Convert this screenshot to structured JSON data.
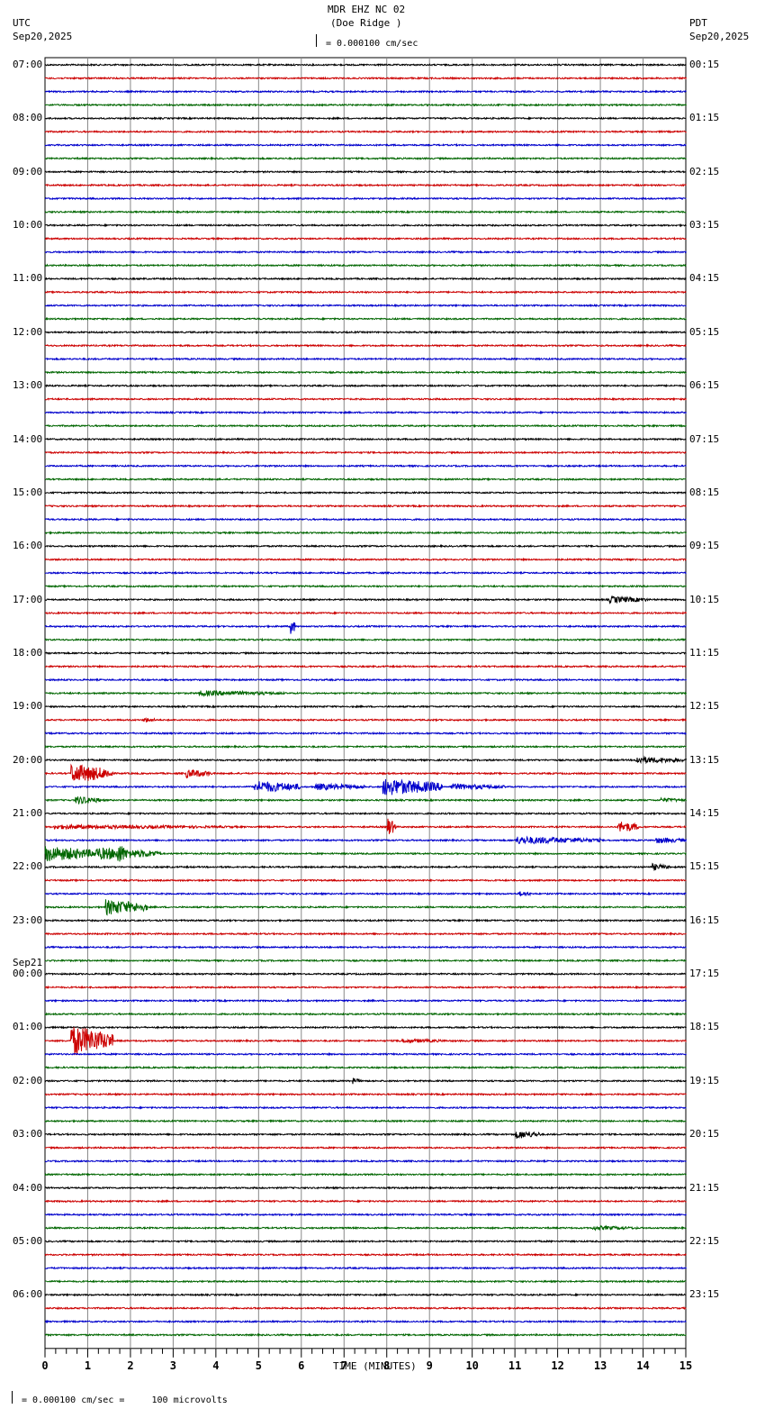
{
  "header": {
    "title": "MDR EHZ NC 02",
    "station": "(Doe Ridge )",
    "scale": "= 0.000100 cm/sec",
    "left_tz": "UTC",
    "left_date": "Sep20,2025",
    "right_tz": "PDT",
    "right_date": "Sep20,2025",
    "day_change": "Sep21"
  },
  "footer": {
    "scale_note": "= 0.000100 cm/sec =     100 microvolts"
  },
  "chart_data": {
    "type": "line",
    "title": "MDR EHZ NC 02 (Doe Ridge )",
    "xlabel": "TIME (MINUTES)",
    "xlim": [
      0,
      15
    ],
    "x_ticks": [
      "0",
      "1",
      "2",
      "3",
      "4",
      "5",
      "6",
      "7",
      "8",
      "9",
      "10",
      "11",
      "12",
      "13",
      "14",
      "15"
    ],
    "trace_colors": [
      "#000000",
      "#cc0000",
      "#0000cc",
      "#006600"
    ],
    "traces_per_hour": 4,
    "trace_count": 96,
    "utc_labels": [
      "07:00",
      "08:00",
      "09:00",
      "10:00",
      "11:00",
      "12:00",
      "13:00",
      "14:00",
      "15:00",
      "16:00",
      "17:00",
      "18:00",
      "19:00",
      "20:00",
      "21:00",
      "22:00",
      "23:00",
      "00:00",
      "01:00",
      "02:00",
      "03:00",
      "04:00",
      "05:00",
      "06:00"
    ],
    "pdt_labels": [
      "00:15",
      "01:15",
      "02:15",
      "03:15",
      "04:15",
      "05:15",
      "06:15",
      "07:15",
      "08:15",
      "09:15",
      "10:15",
      "11:15",
      "12:15",
      "13:15",
      "14:15",
      "15:15",
      "16:15",
      "17:15",
      "18:15",
      "19:15",
      "20:15",
      "21:15",
      "22:15",
      "23:15"
    ],
    "events": [
      {
        "trace": 40,
        "start": 13.2,
        "end": 14.1,
        "amp": 8
      },
      {
        "trace": 42,
        "start": 5.75,
        "end": 5.85,
        "amp": 22
      },
      {
        "trace": 47,
        "start": 3.6,
        "end": 5.6,
        "amp": 6
      },
      {
        "trace": 49,
        "start": 2.3,
        "end": 2.6,
        "amp": 6
      },
      {
        "trace": 52,
        "start": 13.8,
        "end": 15.0,
        "amp": 8
      },
      {
        "trace": 53,
        "start": 0.6,
        "end": 1.6,
        "amp": 22
      },
      {
        "trace": 53,
        "start": 3.3,
        "end": 3.9,
        "amp": 10
      },
      {
        "trace": 54,
        "start": 4.9,
        "end": 6.0,
        "amp": 14
      },
      {
        "trace": 54,
        "start": 6.3,
        "end": 7.5,
        "amp": 8
      },
      {
        "trace": 54,
        "start": 7.9,
        "end": 9.3,
        "amp": 20
      },
      {
        "trace": 54,
        "start": 9.5,
        "end": 10.8,
        "amp": 7
      },
      {
        "trace": 55,
        "start": 0.7,
        "end": 1.3,
        "amp": 10
      },
      {
        "trace": 55,
        "start": 14.4,
        "end": 15.0,
        "amp": 5
      },
      {
        "trace": 57,
        "start": 0.2,
        "end": 4.5,
        "amp": 5
      },
      {
        "trace": 57,
        "start": 8.0,
        "end": 8.2,
        "amp": 22
      },
      {
        "trace": 57,
        "start": 13.4,
        "end": 13.9,
        "amp": 14
      },
      {
        "trace": 58,
        "start": 11.0,
        "end": 13.0,
        "amp": 9
      },
      {
        "trace": 58,
        "start": 14.3,
        "end": 15.0,
        "amp": 7
      },
      {
        "trace": 59,
        "start": 0.0,
        "end": 1.2,
        "amp": 18
      },
      {
        "trace": 59,
        "start": 1.2,
        "end": 2.7,
        "amp": 14
      },
      {
        "trace": 59,
        "start": 1.7,
        "end": 1.9,
        "amp": 26
      },
      {
        "trace": 60,
        "start": 14.2,
        "end": 14.6,
        "amp": 8
      },
      {
        "trace": 62,
        "start": 11.1,
        "end": 11.4,
        "amp": 6
      },
      {
        "trace": 63,
        "start": 1.4,
        "end": 2.4,
        "amp": 18
      },
      {
        "trace": 73,
        "start": 0.6,
        "end": 1.6,
        "amp": 35
      },
      {
        "trace": 73,
        "start": 8.3,
        "end": 9.4,
        "amp": 5
      },
      {
        "trace": 76,
        "start": 7.2,
        "end": 7.4,
        "amp": 7
      },
      {
        "trace": 80,
        "start": 11.0,
        "end": 11.6,
        "amp": 10
      },
      {
        "trace": 87,
        "start": 12.8,
        "end": 13.9,
        "amp": 5
      }
    ]
  }
}
